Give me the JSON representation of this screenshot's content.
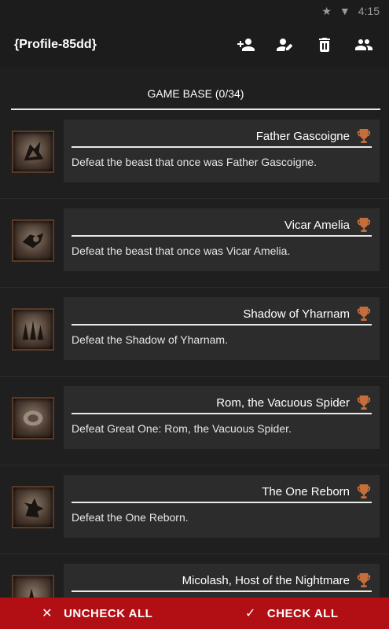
{
  "status_bar": {
    "time": "4:15",
    "icons": [
      "star-icon",
      "wifi-icon"
    ]
  },
  "app_bar": {
    "title": "{Profile-85dd}",
    "actions": [
      "add-person-icon",
      "edit-icon",
      "delete-icon",
      "group-icon"
    ]
  },
  "section": {
    "label": "GAME BASE (0/34)"
  },
  "trophies": [
    {
      "title": "Father Gascoigne",
      "description": "Defeat the beast that once was Father Gascoigne.",
      "icon": "bronze-trophy-icon"
    },
    {
      "title": "Vicar Amelia",
      "description": "Defeat the beast that once was Vicar Amelia.",
      "icon": "bronze-trophy-icon"
    },
    {
      "title": "Shadow of Yharnam",
      "description": "Defeat the Shadow of Yharnam.",
      "icon": "bronze-trophy-icon"
    },
    {
      "title": "Rom, the Vacuous Spider",
      "description": "Defeat Great One: Rom, the Vacuous Spider.",
      "icon": "bronze-trophy-icon"
    },
    {
      "title": "The One Reborn",
      "description": "Defeat the One Reborn.",
      "icon": "bronze-trophy-icon"
    },
    {
      "title": "Micolash, Host of the Nightmare",
      "description": "",
      "icon": "bronze-trophy-icon"
    }
  ],
  "bottom_bar": {
    "uncheck_label": "UNCHECK ALL",
    "check_label": "CHECK ALL",
    "uncheck_glyph": "✕",
    "check_glyph": "✓"
  },
  "colors": {
    "background": "#1f1f1f",
    "card": "#2c2c2c",
    "accent_bar": "#b20f14",
    "trophy_bronze": "#c56e3c"
  }
}
